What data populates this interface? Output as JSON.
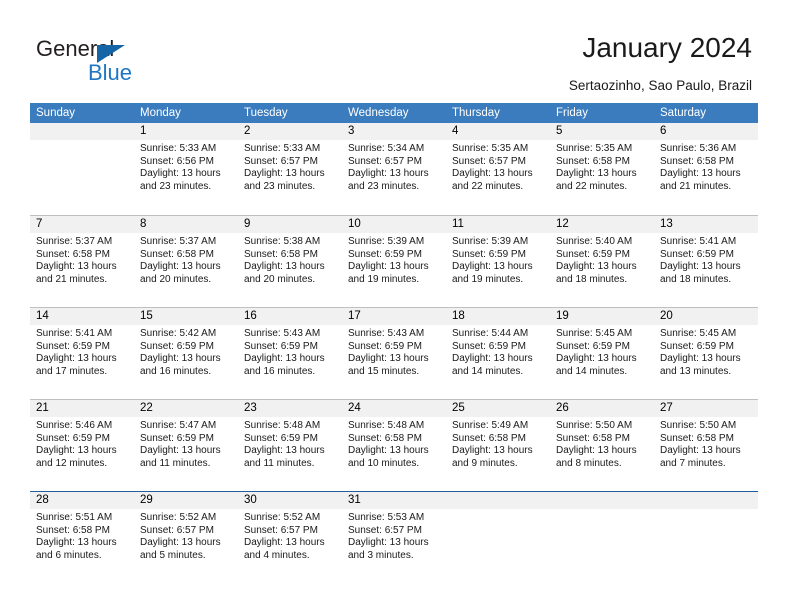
{
  "brand": {
    "name_top": "General",
    "name_bottom": "Blue",
    "triangle_color": "#1565a6",
    "blue_text_color": "#1f77c4"
  },
  "header": {
    "title": "January 2024",
    "subtitle": "Sertaozinho, Sao Paulo, Brazil"
  },
  "calendar": {
    "header_bg": "#3a7cbe",
    "day_band_bg": "#f1f1f1",
    "weekdays": [
      "Sunday",
      "Monday",
      "Tuesday",
      "Wednesday",
      "Thursday",
      "Friday",
      "Saturday"
    ],
    "weeks": [
      [
        {
          "day": "",
          "empty": true,
          "sunrise": "",
          "sunset": "",
          "daylight_line1": "",
          "daylight_line2": ""
        },
        {
          "day": "1",
          "sunrise": "Sunrise: 5:33 AM",
          "sunset": "Sunset: 6:56 PM",
          "daylight_line1": "Daylight: 13 hours",
          "daylight_line2": "and 23 minutes."
        },
        {
          "day": "2",
          "sunrise": "Sunrise: 5:33 AM",
          "sunset": "Sunset: 6:57 PM",
          "daylight_line1": "Daylight: 13 hours",
          "daylight_line2": "and 23 minutes."
        },
        {
          "day": "3",
          "sunrise": "Sunrise: 5:34 AM",
          "sunset": "Sunset: 6:57 PM",
          "daylight_line1": "Daylight: 13 hours",
          "daylight_line2": "and 23 minutes."
        },
        {
          "day": "4",
          "sunrise": "Sunrise: 5:35 AM",
          "sunset": "Sunset: 6:57 PM",
          "daylight_line1": "Daylight: 13 hours",
          "daylight_line2": "and 22 minutes."
        },
        {
          "day": "5",
          "sunrise": "Sunrise: 5:35 AM",
          "sunset": "Sunset: 6:58 PM",
          "daylight_line1": "Daylight: 13 hours",
          "daylight_line2": "and 22 minutes."
        },
        {
          "day": "6",
          "sunrise": "Sunrise: 5:36 AM",
          "sunset": "Sunset: 6:58 PM",
          "daylight_line1": "Daylight: 13 hours",
          "daylight_line2": "and 21 minutes."
        }
      ],
      [
        {
          "day": "7",
          "sunrise": "Sunrise: 5:37 AM",
          "sunset": "Sunset: 6:58 PM",
          "daylight_line1": "Daylight: 13 hours",
          "daylight_line2": "and 21 minutes."
        },
        {
          "day": "8",
          "sunrise": "Sunrise: 5:37 AM",
          "sunset": "Sunset: 6:58 PM",
          "daylight_line1": "Daylight: 13 hours",
          "daylight_line2": "and 20 minutes."
        },
        {
          "day": "9",
          "sunrise": "Sunrise: 5:38 AM",
          "sunset": "Sunset: 6:58 PM",
          "daylight_line1": "Daylight: 13 hours",
          "daylight_line2": "and 20 minutes."
        },
        {
          "day": "10",
          "sunrise": "Sunrise: 5:39 AM",
          "sunset": "Sunset: 6:59 PM",
          "daylight_line1": "Daylight: 13 hours",
          "daylight_line2": "and 19 minutes."
        },
        {
          "day": "11",
          "sunrise": "Sunrise: 5:39 AM",
          "sunset": "Sunset: 6:59 PM",
          "daylight_line1": "Daylight: 13 hours",
          "daylight_line2": "and 19 minutes."
        },
        {
          "day": "12",
          "sunrise": "Sunrise: 5:40 AM",
          "sunset": "Sunset: 6:59 PM",
          "daylight_line1": "Daylight: 13 hours",
          "daylight_line2": "and 18 minutes."
        },
        {
          "day": "13",
          "sunrise": "Sunrise: 5:41 AM",
          "sunset": "Sunset: 6:59 PM",
          "daylight_line1": "Daylight: 13 hours",
          "daylight_line2": "and 18 minutes."
        }
      ],
      [
        {
          "day": "14",
          "sunrise": "Sunrise: 5:41 AM",
          "sunset": "Sunset: 6:59 PM",
          "daylight_line1": "Daylight: 13 hours",
          "daylight_line2": "and 17 minutes."
        },
        {
          "day": "15",
          "sunrise": "Sunrise: 5:42 AM",
          "sunset": "Sunset: 6:59 PM",
          "daylight_line1": "Daylight: 13 hours",
          "daylight_line2": "and 16 minutes."
        },
        {
          "day": "16",
          "sunrise": "Sunrise: 5:43 AM",
          "sunset": "Sunset: 6:59 PM",
          "daylight_line1": "Daylight: 13 hours",
          "daylight_line2": "and 16 minutes."
        },
        {
          "day": "17",
          "sunrise": "Sunrise: 5:43 AM",
          "sunset": "Sunset: 6:59 PM",
          "daylight_line1": "Daylight: 13 hours",
          "daylight_line2": "and 15 minutes."
        },
        {
          "day": "18",
          "sunrise": "Sunrise: 5:44 AM",
          "sunset": "Sunset: 6:59 PM",
          "daylight_line1": "Daylight: 13 hours",
          "daylight_line2": "and 14 minutes."
        },
        {
          "day": "19",
          "sunrise": "Sunrise: 5:45 AM",
          "sunset": "Sunset: 6:59 PM",
          "daylight_line1": "Daylight: 13 hours",
          "daylight_line2": "and 14 minutes."
        },
        {
          "day": "20",
          "sunrise": "Sunrise: 5:45 AM",
          "sunset": "Sunset: 6:59 PM",
          "daylight_line1": "Daylight: 13 hours",
          "daylight_line2": "and 13 minutes."
        }
      ],
      [
        {
          "day": "21",
          "sunrise": "Sunrise: 5:46 AM",
          "sunset": "Sunset: 6:59 PM",
          "daylight_line1": "Daylight: 13 hours",
          "daylight_line2": "and 12 minutes."
        },
        {
          "day": "22",
          "sunrise": "Sunrise: 5:47 AM",
          "sunset": "Sunset: 6:59 PM",
          "daylight_line1": "Daylight: 13 hours",
          "daylight_line2": "and 11 minutes."
        },
        {
          "day": "23",
          "sunrise": "Sunrise: 5:48 AM",
          "sunset": "Sunset: 6:59 PM",
          "daylight_line1": "Daylight: 13 hours",
          "daylight_line2": "and 11 minutes."
        },
        {
          "day": "24",
          "sunrise": "Sunrise: 5:48 AM",
          "sunset": "Sunset: 6:58 PM",
          "daylight_line1": "Daylight: 13 hours",
          "daylight_line2": "and 10 minutes."
        },
        {
          "day": "25",
          "sunrise": "Sunrise: 5:49 AM",
          "sunset": "Sunset: 6:58 PM",
          "daylight_line1": "Daylight: 13 hours",
          "daylight_line2": "and 9 minutes."
        },
        {
          "day": "26",
          "sunrise": "Sunrise: 5:50 AM",
          "sunset": "Sunset: 6:58 PM",
          "daylight_line1": "Daylight: 13 hours",
          "daylight_line2": "and 8 minutes."
        },
        {
          "day": "27",
          "sunrise": "Sunrise: 5:50 AM",
          "sunset": "Sunset: 6:58 PM",
          "daylight_line1": "Daylight: 13 hours",
          "daylight_line2": "and 7 minutes."
        }
      ],
      [
        {
          "day": "28",
          "sunrise": "Sunrise: 5:51 AM",
          "sunset": "Sunset: 6:58 PM",
          "daylight_line1": "Daylight: 13 hours",
          "daylight_line2": "and 6 minutes."
        },
        {
          "day": "29",
          "sunrise": "Sunrise: 5:52 AM",
          "sunset": "Sunset: 6:57 PM",
          "daylight_line1": "Daylight: 13 hours",
          "daylight_line2": "and 5 minutes."
        },
        {
          "day": "30",
          "sunrise": "Sunrise: 5:52 AM",
          "sunset": "Sunset: 6:57 PM",
          "daylight_line1": "Daylight: 13 hours",
          "daylight_line2": "and 4 minutes."
        },
        {
          "day": "31",
          "sunrise": "Sunrise: 5:53 AM",
          "sunset": "Sunset: 6:57 PM",
          "daylight_line1": "Daylight: 13 hours",
          "daylight_line2": "and 3 minutes."
        },
        {
          "day": "",
          "empty": true,
          "sunrise": "",
          "sunset": "",
          "daylight_line1": "",
          "daylight_line2": ""
        },
        {
          "day": "",
          "empty": true,
          "sunrise": "",
          "sunset": "",
          "daylight_line1": "",
          "daylight_line2": ""
        },
        {
          "day": "",
          "empty": true,
          "sunrise": "",
          "sunset": "",
          "daylight_line1": "",
          "daylight_line2": ""
        }
      ]
    ]
  }
}
